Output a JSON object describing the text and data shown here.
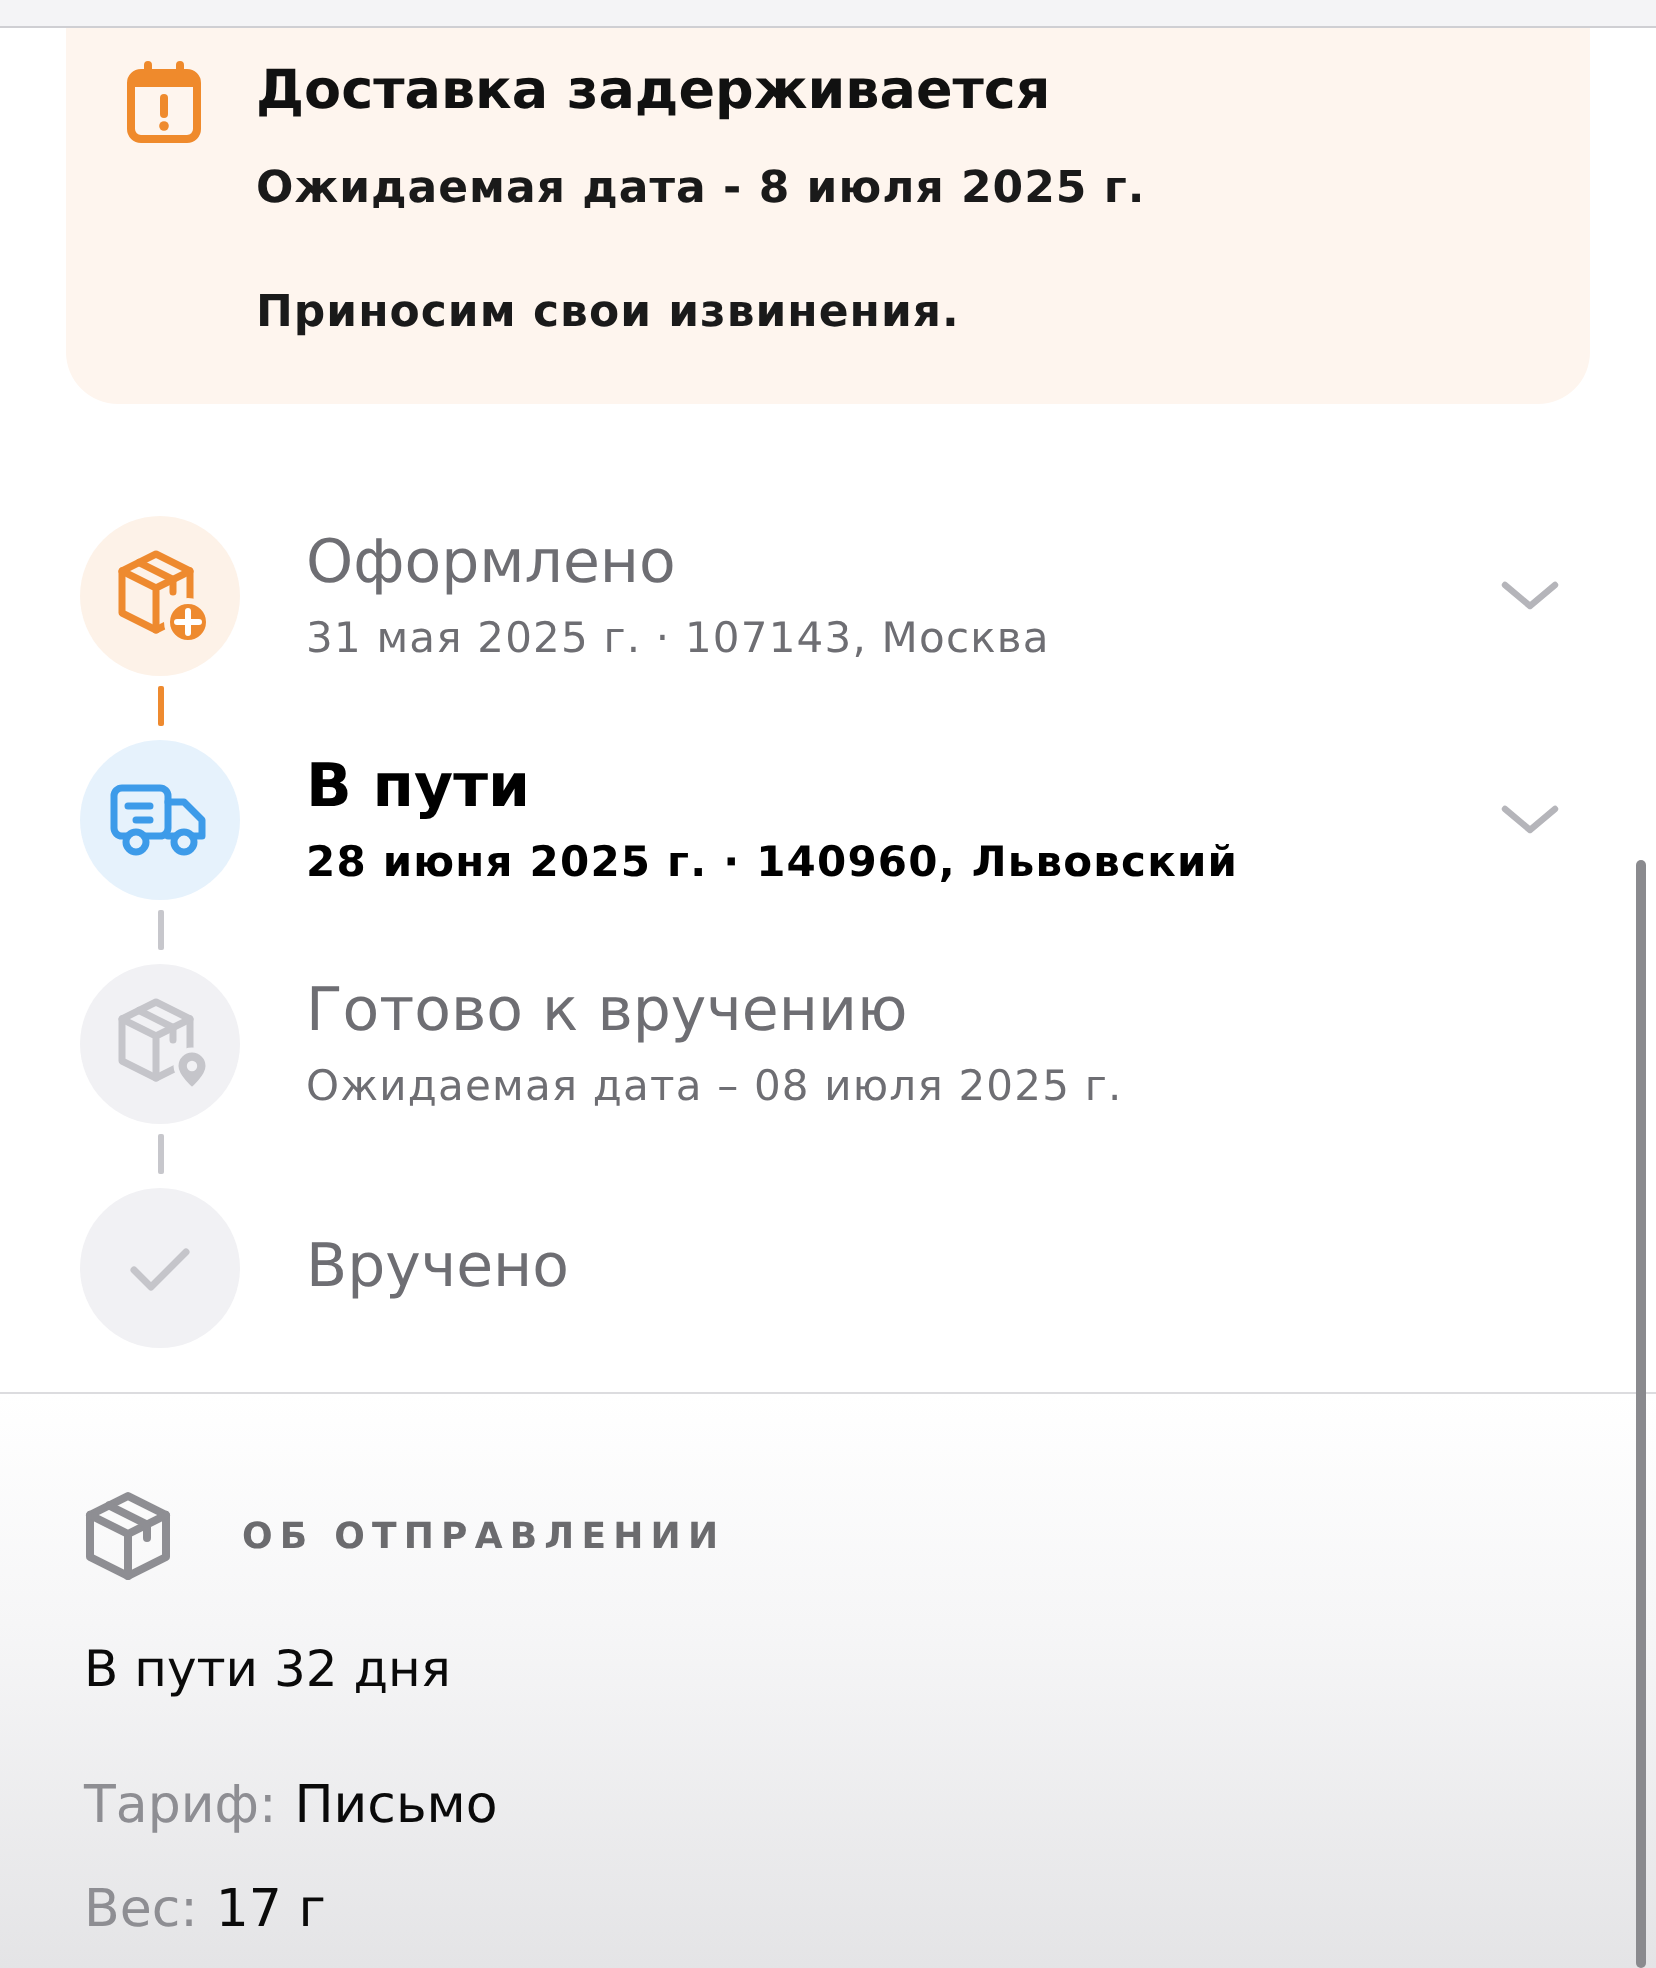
{
  "alert": {
    "title": "Доставка задерживается",
    "lines": [
      "Ожидаемая дата - 8 июля 2025 г.",
      "Приносим свои извинения."
    ]
  },
  "timeline": [
    {
      "kind": "registered",
      "done": true,
      "current": false,
      "title": "Оформлено",
      "subtitle": "31 мая 2025 г. · 107143, Москва",
      "expandable": true
    },
    {
      "kind": "transit",
      "done": false,
      "current": true,
      "title": "В пути",
      "subtitle": "28 июня 2025 г. · 140960, Львовский",
      "expandable": true
    },
    {
      "kind": "pickup",
      "done": false,
      "current": false,
      "title": "Готово к вручению",
      "subtitle": "Ожидаемая дата – 08 июля 2025 г.",
      "expandable": false
    },
    {
      "kind": "delivered",
      "done": false,
      "current": false,
      "title": "Вручено",
      "expandable": false
    }
  ],
  "details": {
    "heading": "ОБ ОТПРАВЛЕНИИ",
    "summary": "В пути 32 дня",
    "fields": [
      {
        "label": "Тариф:",
        "value": "Письмо"
      },
      {
        "label": "Вес:",
        "value": "17 г"
      }
    ]
  }
}
